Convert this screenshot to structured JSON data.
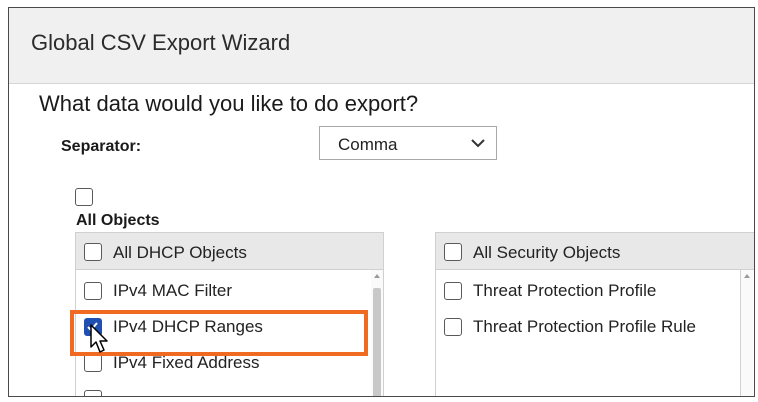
{
  "window": {
    "title": "Global CSV Export Wizard"
  },
  "question": "What data would you like to do export?",
  "separator": {
    "label": "Separator:",
    "value": "Comma"
  },
  "all_objects": {
    "label": "All Objects",
    "checked": false
  },
  "dhcp_panel": {
    "header": "All DHCP Objects",
    "items": [
      {
        "label": "IPv4 MAC Filter",
        "checked": false
      },
      {
        "label": "IPv4 DHCP Ranges",
        "checked": true
      },
      {
        "label": "IPv4 Fixed Address",
        "checked": false
      }
    ]
  },
  "security_panel": {
    "header": "All Security Objects",
    "items": [
      {
        "label": "Threat Protection Profile",
        "checked": false
      },
      {
        "label": "Threat Protection Profile Rule",
        "checked": false
      }
    ]
  },
  "colors": {
    "highlight": "#f06a21",
    "checkbox_checked": "#1f4fb0",
    "header_bg": "#f0f0f0"
  },
  "icons": [
    "chevron-down-icon",
    "mouse-pointer-icon"
  ]
}
